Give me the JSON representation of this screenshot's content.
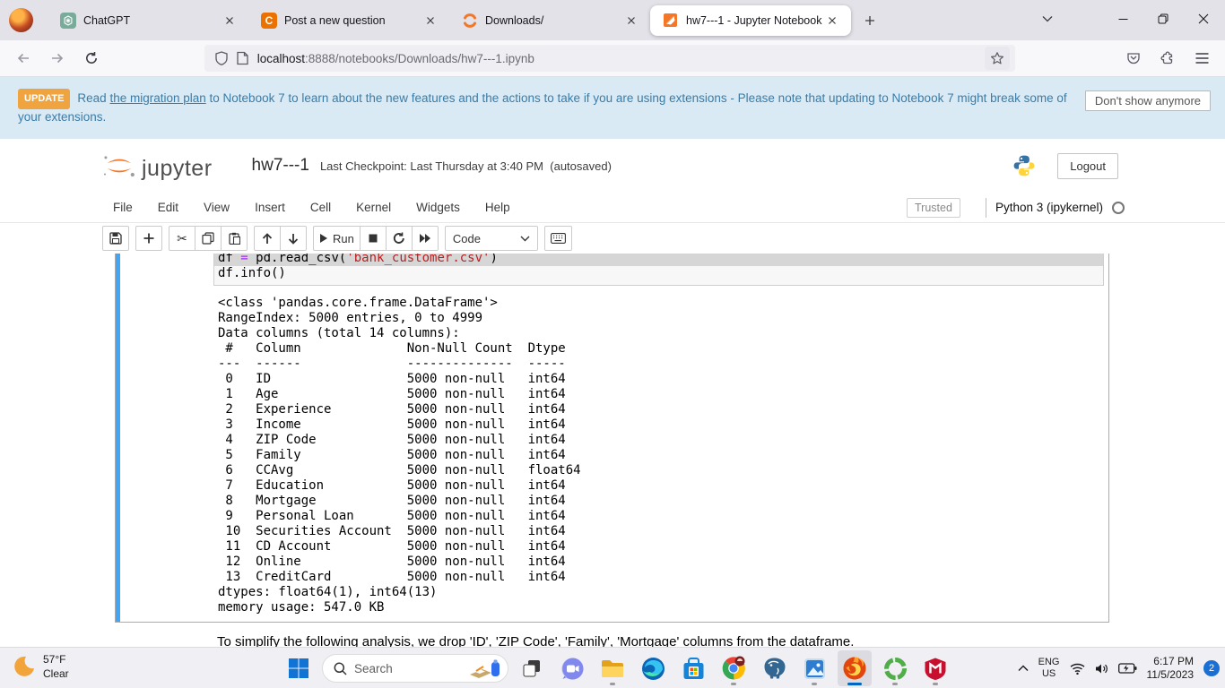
{
  "browser": {
    "tabs": [
      {
        "title": "ChatGPT"
      },
      {
        "title": "Post a new question",
        "icon_letter": "C"
      },
      {
        "title": "Downloads/"
      },
      {
        "title": "hw7---1 - Jupyter Notebook"
      }
    ],
    "address": {
      "host": "localhost",
      "rest": ":8888/notebooks/Downloads/hw7---1.ipynb"
    }
  },
  "banner": {
    "badge": "UPDATE",
    "before_link": "Read ",
    "link": "the migration plan",
    "after_link": " to Notebook 7 to learn about the new features and the actions to take if you are using extensions - Please note that updating to Notebook 7 might break some of your extensions.",
    "dismiss": "Don't show anymore"
  },
  "jupyter": {
    "logo_text": "jupyter",
    "title": "hw7---1",
    "checkpoint": "Last Checkpoint: Last Thursday at 3:40 PM",
    "autosave": "(autosaved)",
    "logout": "Logout",
    "menu": [
      "File",
      "Edit",
      "View",
      "Insert",
      "Cell",
      "Kernel",
      "Widgets",
      "Help"
    ],
    "trusted": "Trusted",
    "kernel": "Python 3 (ipykernel)",
    "toolbar": {
      "run": "Run",
      "cell_type": "Code"
    }
  },
  "cell": {
    "code": {
      "var": "df ",
      "op": "= ",
      "call": "pd.read_csv(",
      "string": "'bank_customer.csv'",
      "close": ")",
      "line2": "df.info()"
    },
    "output": "<class 'pandas.core.frame.DataFrame'>\nRangeIndex: 5000 entries, 0 to 4999\nData columns (total 14 columns):\n #   Column              Non-Null Count  Dtype  \n---  ------              --------------  -----  \n 0   ID                  5000 non-null   int64  \n 1   Age                 5000 non-null   int64  \n 2   Experience          5000 non-null   int64  \n 3   Income              5000 non-null   int64  \n 4   ZIP Code            5000 non-null   int64  \n 5   Family              5000 non-null   int64  \n 6   CCAvg               5000 non-null   float64\n 7   Education           5000 non-null   int64  \n 8   Mortgage            5000 non-null   int64  \n 9   Personal Loan       5000 non-null   int64  \n 10  Securities Account  5000 non-null   int64  \n 11  CD Account          5000 non-null   int64  \n 12  Online              5000 non-null   int64  \n 13  CreditCard          5000 non-null   int64  \ndtypes: float64(1), int64(13)\nmemory usage: 547.0 KB"
  },
  "markdown_below": "To simplify the following analysis, we drop 'ID', 'ZIP Code', 'Family', 'Mortgage' columns from the dataframe.",
  "taskbar": {
    "weather_temp": "57°F",
    "weather_cond": "Clear",
    "search_placeholder": "Search",
    "apps": [
      "task-view",
      "chat",
      "file-explorer",
      "edge",
      "microsoft-store",
      "chrome",
      "postgresql",
      "photos",
      "firefox",
      "green-ring-app",
      "mcafee"
    ],
    "tray": {
      "lang_top": "ENG",
      "lang_bottom": "US",
      "time": "6:17 PM",
      "date": "11/5/2023",
      "badge": "2"
    }
  },
  "glyphs": {
    "scissors": "✂"
  }
}
